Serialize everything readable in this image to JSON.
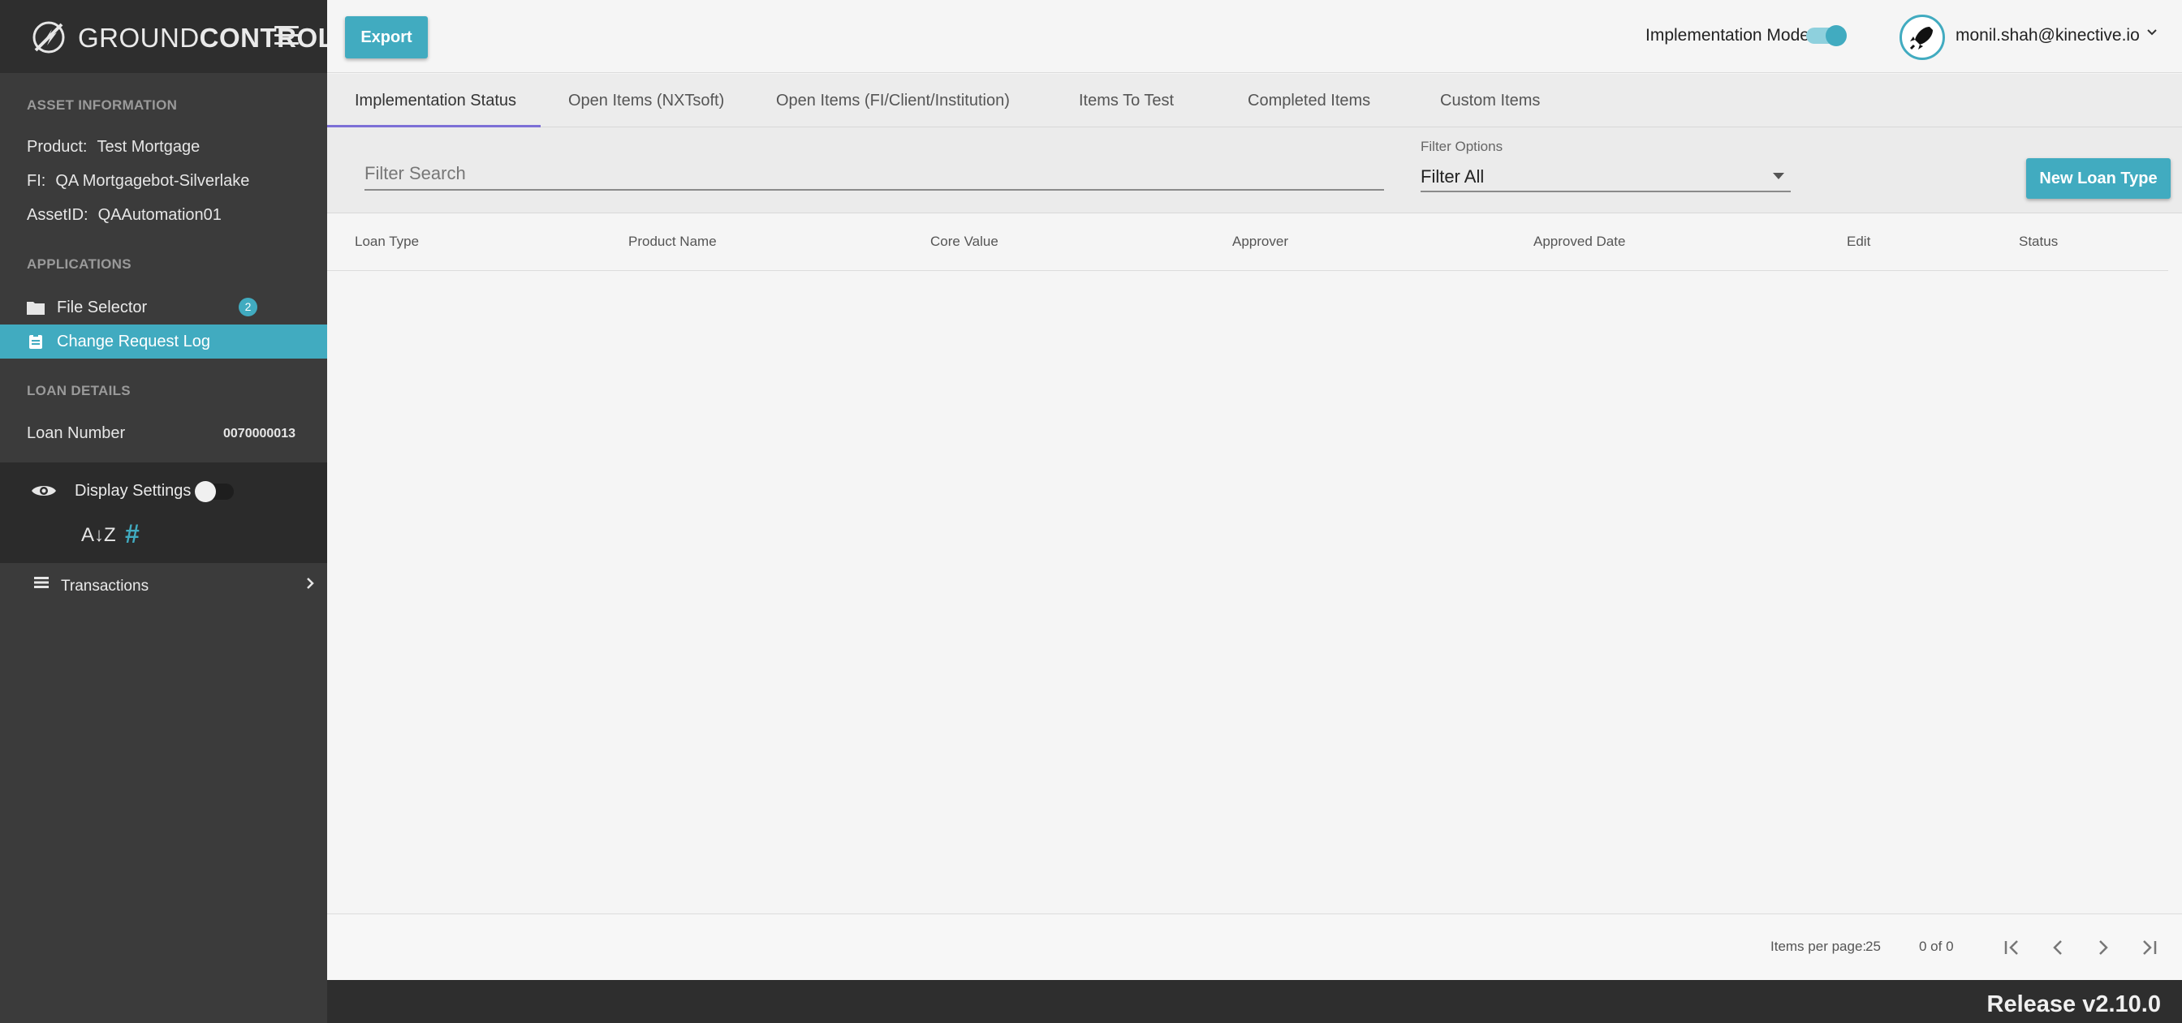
{
  "brand": {
    "name_part1": "GROUND",
    "name_part2": "CONTROL"
  },
  "sidebar": {
    "asset_info_title": "ASSET INFORMATION",
    "product_label": "Product:",
    "product_value": "Test Mortgage",
    "fi_label": "FI:",
    "fi_value": "QA Mortgagebot-Silverlake",
    "asset_id_label": "AssetID:",
    "asset_id_value": "QAAutomation01",
    "applications_title": "APPLICATIONS",
    "apps": [
      {
        "label": "File Selector",
        "icon": "folder-icon",
        "badge": "2",
        "active": false
      },
      {
        "label": "Change Request Log",
        "icon": "clipboard-icon",
        "active": true
      }
    ],
    "loan_details_title": "LOAN DETAILS",
    "loan_number_label": "Loan Number",
    "loan_number_value": "0070000013",
    "display_settings_label": "Display Settings",
    "display_settings_on": false,
    "sort_az_icon": "A↓Z",
    "hash_icon": "#",
    "transactions_label": "Transactions"
  },
  "topbar": {
    "export_label": "Export",
    "implementation_mode_label": "Implementation Mode",
    "implementation_mode_on": true,
    "user_email": "monil.shah@kinective.io"
  },
  "tabs": [
    {
      "label": "Implementation Status",
      "active": true
    },
    {
      "label": "Open Items (NXTsoft)",
      "active": false
    },
    {
      "label": "Open Items (FI/Client/Institution)",
      "active": false
    },
    {
      "label": "Items To Test",
      "active": false
    },
    {
      "label": "Completed Items",
      "active": false
    },
    {
      "label": "Custom Items",
      "active": false
    }
  ],
  "filter": {
    "search_placeholder": "Filter Search",
    "options_label": "Filter Options",
    "selected": "Filter All",
    "new_button_label": "New Loan Type"
  },
  "table": {
    "columns": [
      "Loan Type",
      "Product Name",
      "Core Value",
      "Approver",
      "Approved Date",
      "Edit",
      "Status"
    ],
    "rows": []
  },
  "paginator": {
    "items_per_page_label": "Items per page:",
    "items_per_page": "25",
    "range": "0 of 0"
  },
  "footer": {
    "release": "Release v2.10.0"
  },
  "colors": {
    "accent": "#41abc0",
    "sidebar_bg": "#3b3b3b",
    "tab_indicator": "#7c6fd6"
  }
}
